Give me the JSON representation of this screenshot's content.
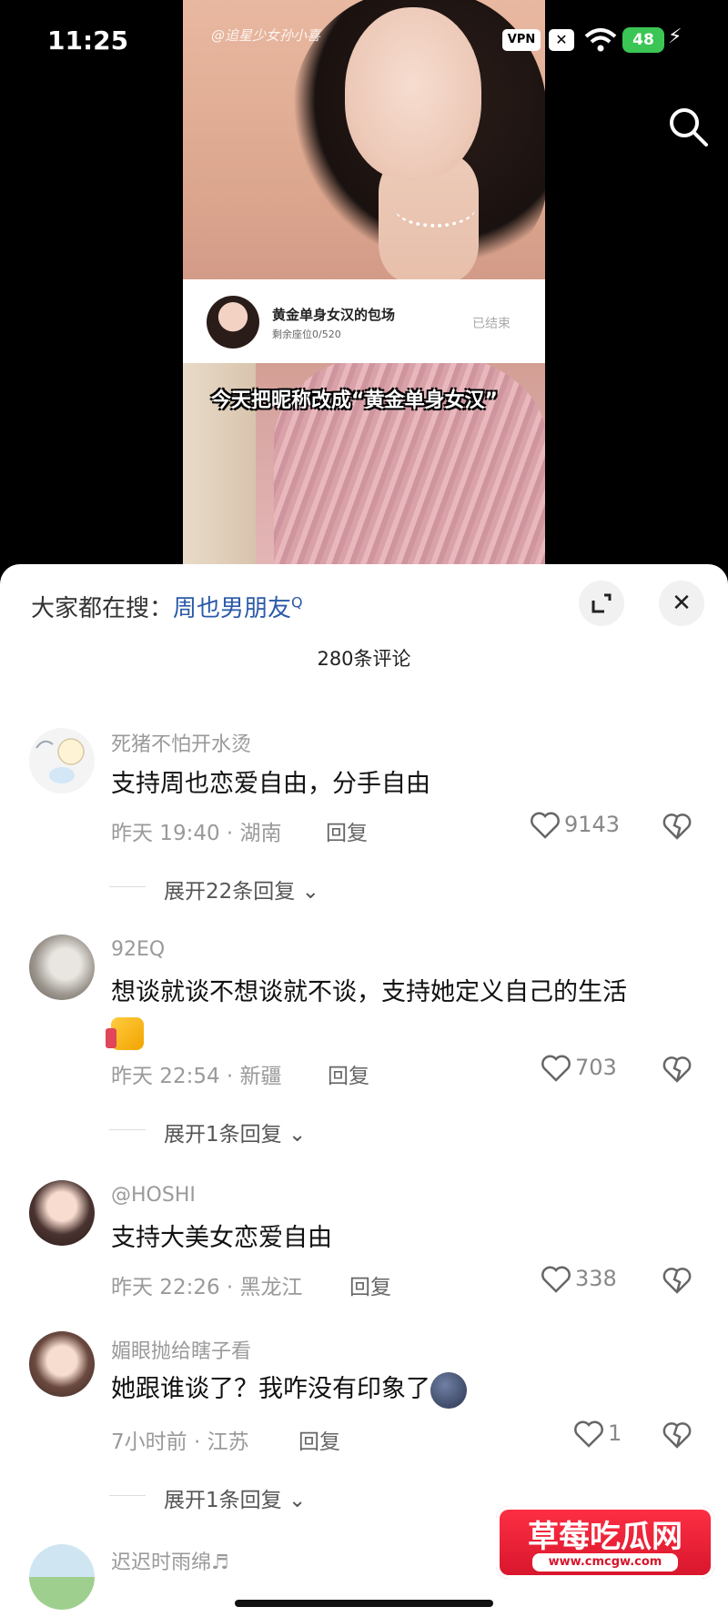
{
  "status_bar": {
    "time": "11:25",
    "vpn": "VPN",
    "battery": "48"
  },
  "video": {
    "watermark": "@追星少女孙小喜",
    "live_card": {
      "title": "黄金单身女汉的包场",
      "subtitle": "剩余座位0/520",
      "status": "已结束"
    },
    "caption": "今天把昵称改成“黄金单身女汉”"
  },
  "sheet": {
    "search_prefix": "大家都在搜：",
    "search_keyword": "周也男朋友",
    "comment_count": "280条评论"
  },
  "comments": [
    {
      "user": "死猪不怕开水烫",
      "text": "支持周也恋爱自由，分手自由",
      "time": "昨天 19:40 · 湖南",
      "reply": "回复",
      "likes": "9143",
      "expand": "展开22条回复"
    },
    {
      "user": "92EQ",
      "text": "想谈就谈不想谈就不谈，支持她定义自己的生活",
      "time": "昨天 22:54 · 新疆",
      "reply": "回复",
      "likes": "703",
      "expand": "展开1条回复"
    },
    {
      "user": "@HOSHI",
      "text": "支持大美女恋爱自由",
      "time": "昨天 22:26 · 黑龙江",
      "reply": "回复",
      "likes": "338"
    },
    {
      "user": "媚眼抛给瞎子看",
      "text": "她跟谁谈了？我咋没有印象了",
      "time": "7小时前 · 江苏",
      "reply": "回复",
      "likes": "1",
      "expand": "展开1条回复"
    },
    {
      "user": "迟迟时雨绵♬"
    }
  ],
  "brand": {
    "name": "草莓吃瓜网",
    "url": "www.cmcgw.com"
  },
  "colors": {
    "accent": "#2b5aa8",
    "battery": "#3bc554",
    "brand_red": "#d6152b"
  }
}
